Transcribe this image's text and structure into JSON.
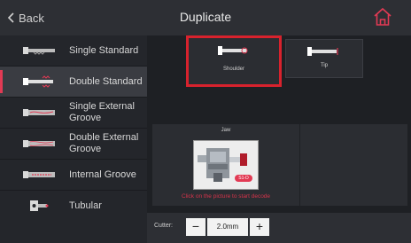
{
  "header": {
    "back_label": "Back",
    "title": "Duplicate",
    "home_icon": "home-icon"
  },
  "sidebar": {
    "items": [
      {
        "label": "Single Standard",
        "icon": "single-standard-key-icon",
        "active": false
      },
      {
        "label": "Double Standard",
        "icon": "double-standard-key-icon",
        "active": true
      },
      {
        "label": "Single External Groove",
        "icon": "single-external-groove-key-icon",
        "active": false
      },
      {
        "label": "Double External Groove",
        "icon": "double-external-groove-key-icon",
        "active": false
      },
      {
        "label": "Internal Groove",
        "icon": "internal-groove-key-icon",
        "active": false
      },
      {
        "label": "Tubular",
        "icon": "tubular-key-icon",
        "active": false
      }
    ]
  },
  "positioning": {
    "options": [
      {
        "label": "Shoulder",
        "selected": true
      },
      {
        "label": "Tip",
        "selected": false
      }
    ]
  },
  "jaw": {
    "title": "Jaw",
    "badge": "S1-D",
    "hint": "Click on the picture to start decode"
  },
  "cutter": {
    "label": "Cutter:",
    "minus": "−",
    "value": "2.0mm",
    "plus": "+"
  },
  "colors": {
    "accent": "#e23a54",
    "selected_border": "#d8222d"
  }
}
